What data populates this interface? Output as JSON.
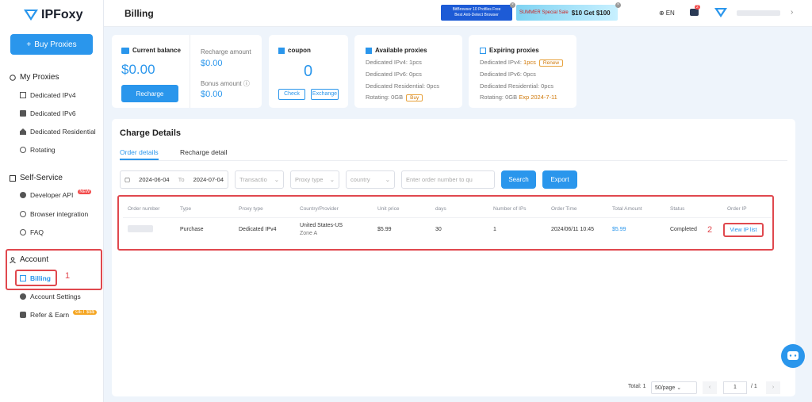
{
  "app": {
    "name": "IPFoxy"
  },
  "sidebar": {
    "buy_label": "Buy Proxies",
    "sections": [
      {
        "label": "My Proxies",
        "items": [
          "Dedicated IPv4",
          "Dedicated IPv6",
          "Dedicated Residential",
          "Rotating"
        ]
      },
      {
        "label": "Self-Service",
        "items": [
          "Developer API",
          "Browser integration",
          "FAQ"
        ],
        "badge": "NEW"
      },
      {
        "label": "Account",
        "items": [
          "Billing",
          "Account Settings",
          "Refer & Earn"
        ],
        "badge": "GET $$$"
      }
    ]
  },
  "header": {
    "title": "Billing",
    "ad1": {
      "line1": "BitBrowser  10 Profiles Free",
      "line2": "Best Anti-Detect Browser"
    },
    "ad2": {
      "text": "SUMMER Special Sale",
      "price": "$10 Get $100"
    },
    "lang": "EN",
    "msg_count": "2"
  },
  "cards": {
    "balance": {
      "title": "Current balance",
      "value": "$0.00",
      "button": "Recharge"
    },
    "recharge": {
      "label1": "Recharge amount",
      "value1": "$0.00",
      "label2": "Bonus amount",
      "value2": "$0.00"
    },
    "coupon": {
      "title": "coupon",
      "value": "0",
      "btn_check": "Check",
      "btn_exchange": "Exchange"
    },
    "available": {
      "title": "Available proxies",
      "ipv4": "Dedicated IPv4: 1pcs",
      "ipv6": "Dedicated IPv6: 0pcs",
      "res": "Dedicated Residential: 0pcs",
      "rot": "Rotating: 0GB",
      "buy": "Buy"
    },
    "expiring": {
      "title": "Expiring proxies",
      "ipv4": "Dedicated IPv4:",
      "ipv4_count": "1pcs",
      "renew": "Renew",
      "ipv6": "Dedicated IPv6: 0pcs",
      "res": "Dedicated Residential: 0pcs",
      "rot": "Rotating: 0GB",
      "exp": "Exp 2024-7-11"
    }
  },
  "charge": {
    "title": "Charge Details",
    "tabs": [
      "Order details",
      "Recharge detail"
    ],
    "filters": {
      "date_from": "2024-06-04",
      "date_to_label": "To",
      "date_to": "2024-07-04",
      "transaction": "Transactio",
      "proxy_type": "Proxy type",
      "country": "country",
      "order_placeholder": "Enter order number to qu",
      "search": "Search",
      "export": "Export"
    },
    "columns": [
      "Order number",
      "Type",
      "Proxy type",
      "Country/Provider",
      "Unit price",
      "days",
      "Number of IPs",
      "Order Time",
      "Total Amount",
      "Status",
      "Order IP"
    ],
    "row": {
      "type": "Purchase",
      "proxy_type": "Dedicated IPv4",
      "country": "United States-US",
      "zone": "Zone A",
      "unit_price": "$5.99",
      "days": "30",
      "ips": "1",
      "time": "2024/06/11 10:45",
      "total": "$5.99",
      "status": "Completed",
      "action": "View IP list"
    },
    "pager": {
      "total": "Total: 1",
      "per_page": "50/page",
      "page": "1",
      "of": "/ 1"
    }
  },
  "annotations": {
    "n1": "1",
    "n2": "2"
  }
}
